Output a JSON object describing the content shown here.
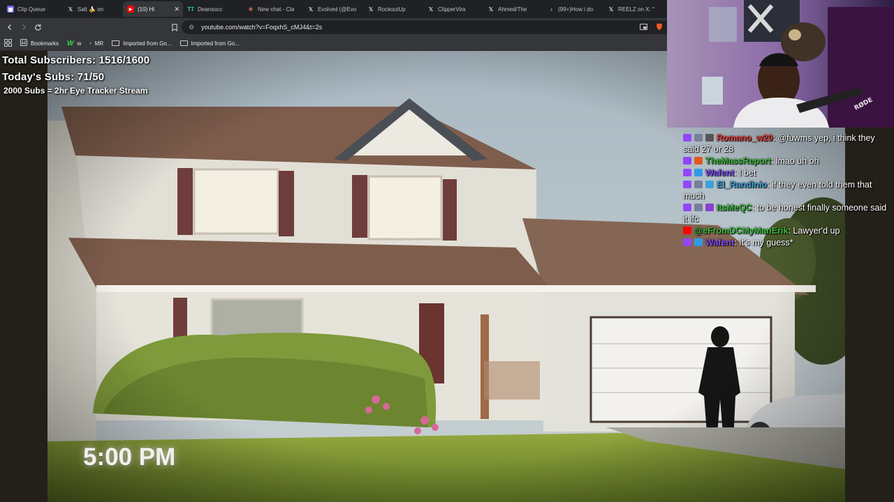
{
  "browser": {
    "tabs": [
      {
        "label": "Clip Queue",
        "icon": "clip-queue-icon",
        "color": "#6e5cf0",
        "active": false
      },
      {
        "label": "Salt 🍌 on",
        "icon": "x-logo-icon",
        "color": "#e8eaed",
        "active": false
      },
      {
        "label": "(10) Hi",
        "icon": "youtube-icon",
        "color": "#ff0000",
        "active": true
      },
      {
        "label": "Deansocc",
        "icon": "tt-icon",
        "color": "#2bd1c6",
        "active": false
      },
      {
        "label": "New chat - Cla",
        "icon": "claude-icon",
        "color": "#d97757",
        "active": false
      },
      {
        "label": "Evolved (@Evo",
        "icon": "x-logo-icon",
        "color": "#e8eaed",
        "active": false
      },
      {
        "label": "RockoutUp",
        "icon": "x-logo-icon",
        "color": "#e8eaed",
        "active": false
      },
      {
        "label": "ClipperVira",
        "icon": "x-logo-icon",
        "color": "#e8eaed",
        "active": false
      },
      {
        "label": "Ahmed/The",
        "icon": "x-logo-icon",
        "color": "#e8eaed",
        "active": false
      },
      {
        "label": "(99+)How i do",
        "icon": "tiktok-icon",
        "color": "#e8eaed",
        "active": false
      },
      {
        "label": "REELZ on X: \"",
        "icon": "x-logo-icon",
        "color": "#e8eaed",
        "active": false
      }
    ],
    "url": "youtube.com/watch?v=FoqxhS_cMJ4&t=2s",
    "bookmarks": [
      {
        "label": "Bookmarks",
        "icon": "bookmarks-icon"
      },
      {
        "label": "w",
        "icon": "w-logo-icon"
      },
      {
        "label": "MR",
        "icon": "mr-icon"
      },
      {
        "label": "Imported from Go...",
        "icon": "folder-icon"
      },
      {
        "label": "Imported from Go...",
        "icon": "folder-icon"
      }
    ]
  },
  "stream_overlay": {
    "total_subscribers": "Total Subscribers: 1516/1600",
    "todays_subs": "Today's Subs: 71/50",
    "promo": "2000 Subs = 2hr Eye Tracker Stream"
  },
  "video": {
    "timestamp_caption": "5:00 PM"
  },
  "webcam": {
    "mic_brand": "RØDE"
  },
  "chat": {
    "messages": [
      {
        "user": "Romano_w29",
        "color": "#e0403a",
        "text": "@fuwms yep, i think they said 27 or 28",
        "badges": [
          "twitch-icon",
          "sub-badge-icon",
          "bits-badge-icon"
        ]
      },
      {
        "user": "TheMassReport",
        "color": "#3fb93f",
        "text": "lmao uh oh",
        "badges": [
          "twitch-icon",
          "hype-badge-icon"
        ]
      },
      {
        "user": "Wafent",
        "color": "#7d4cf0",
        "text": "I bet",
        "badges": [
          "twitch-icon",
          "crown-badge-icon"
        ]
      },
      {
        "user": "El_Randinio",
        "color": "#3ea0d8",
        "text": "if they even told them that much",
        "badges": [
          "twitch-icon",
          "sub-badge-icon",
          "gem-badge-icon"
        ]
      },
      {
        "user": "ItsMeQC",
        "color": "#3fb93f",
        "text": "to be honest finally someone said it ifc",
        "badges": [
          "twitch-icon",
          "sub-badge-icon",
          "video-badge-icon"
        ]
      },
      {
        "user": "@eFromDCMyManErik",
        "color": "#3fb93f",
        "text": "Lawyer'd up",
        "badges": [
          "youtube-icon"
        ]
      },
      {
        "user": "Wafent",
        "color": "#7d4cf0",
        "text": "It's my guess*",
        "badges": [
          "twitch-icon",
          "crown-badge-icon"
        ]
      }
    ]
  }
}
